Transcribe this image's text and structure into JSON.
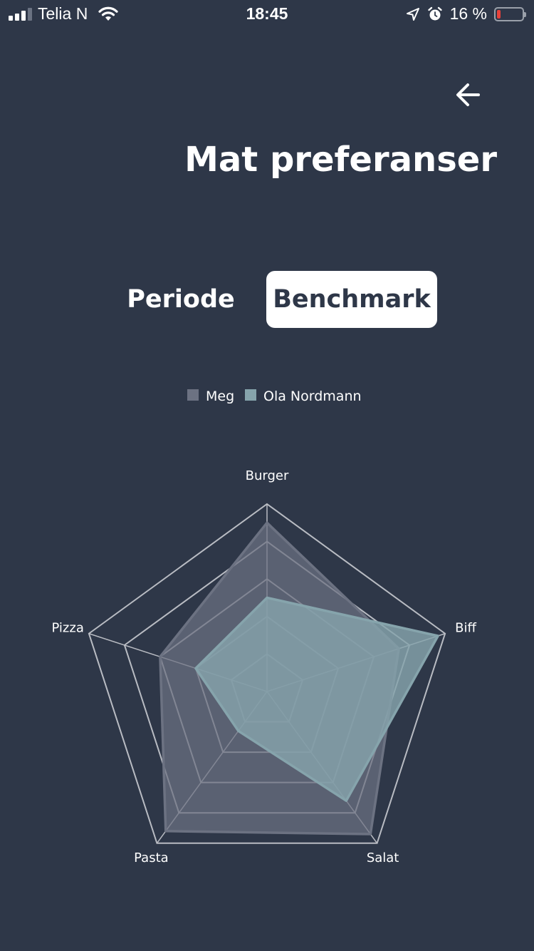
{
  "status_bar": {
    "carrier": "Telia N",
    "time": "18:45",
    "battery_percent": "16 %",
    "battery_level": 0.16
  },
  "header": {
    "back_icon": "arrow-left-icon",
    "title": "Mat preferanser"
  },
  "tabs": [
    {
      "label": "Periode",
      "selected": false
    },
    {
      "label": "Benchmark",
      "selected": true
    }
  ],
  "colors": {
    "background": "#2e3748",
    "meg": "#6c7282",
    "ola": "#86a4ac",
    "grid": "#b9bcc3"
  },
  "chart_data": {
    "type": "radar",
    "categories": [
      "Burger",
      "Biff",
      "Salat",
      "Pasta",
      "Pizza"
    ],
    "rlim": [
      0,
      5
    ],
    "grid_levels": 5,
    "series": [
      {
        "name": "Meg",
        "values": [
          4.5,
          3.7,
          4.7,
          4.6,
          3.0
        ]
      },
      {
        "name": "Ola Nordmann",
        "values": [
          2.5,
          4.8,
          3.6,
          1.3,
          2.0
        ]
      }
    ],
    "legend_position": "top-center"
  }
}
